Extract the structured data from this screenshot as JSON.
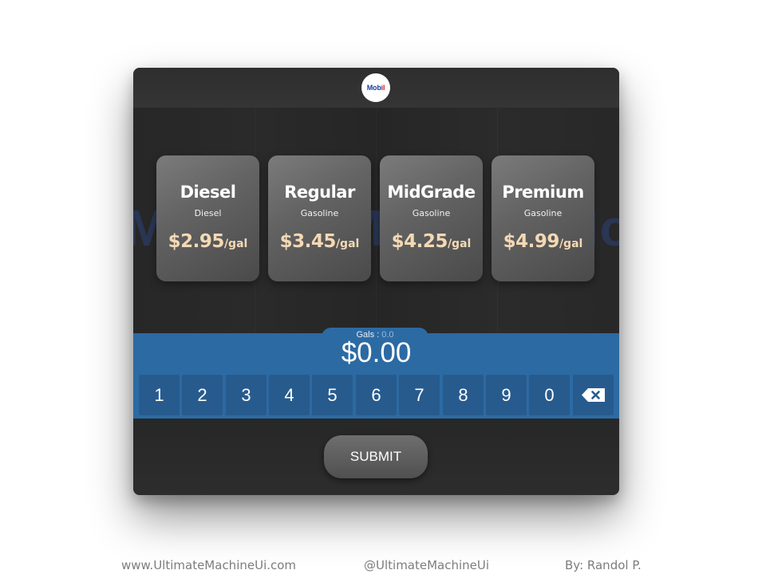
{
  "brand": {
    "logo_text_a": "Mob",
    "logo_text_b": "il",
    "watermark_a": "Mobil",
    "watermark_b": "Mo"
  },
  "fuels": [
    {
      "name": "Diesel",
      "type": "Diesel",
      "price": "$2.95",
      "unit": "/gal"
    },
    {
      "name": "Regular",
      "type": "Gasoline",
      "price": "$3.45",
      "unit": "/gal"
    },
    {
      "name": "MidGrade",
      "type": "Gasoline",
      "price": "$4.25",
      "unit": "/gal"
    },
    {
      "name": "Premium",
      "type": "Gasoline",
      "price": "$4.99",
      "unit": "/gal"
    }
  ],
  "display": {
    "gals_label": "Gals :",
    "gals_value": "0.0",
    "amount": "$0.00"
  },
  "keypad": {
    "keys": [
      "1",
      "2",
      "3",
      "4",
      "5",
      "6",
      "7",
      "8",
      "9",
      "0"
    ],
    "backspace_icon": "backspace-icon"
  },
  "actions": {
    "submit_label": "SUBMIT"
  },
  "footer": {
    "website": "www.UltimateMachineUi.com",
    "handle": "@UltimateMachineUi",
    "author": "By: Randol P."
  },
  "colors": {
    "panel_bg": "#282828",
    "keypad_band": "#2c6aa3",
    "key_bg": "#275b8e",
    "price_text": "#f4d9b5",
    "logo_blue": "#1a3f9c",
    "logo_red": "#d6202a"
  }
}
